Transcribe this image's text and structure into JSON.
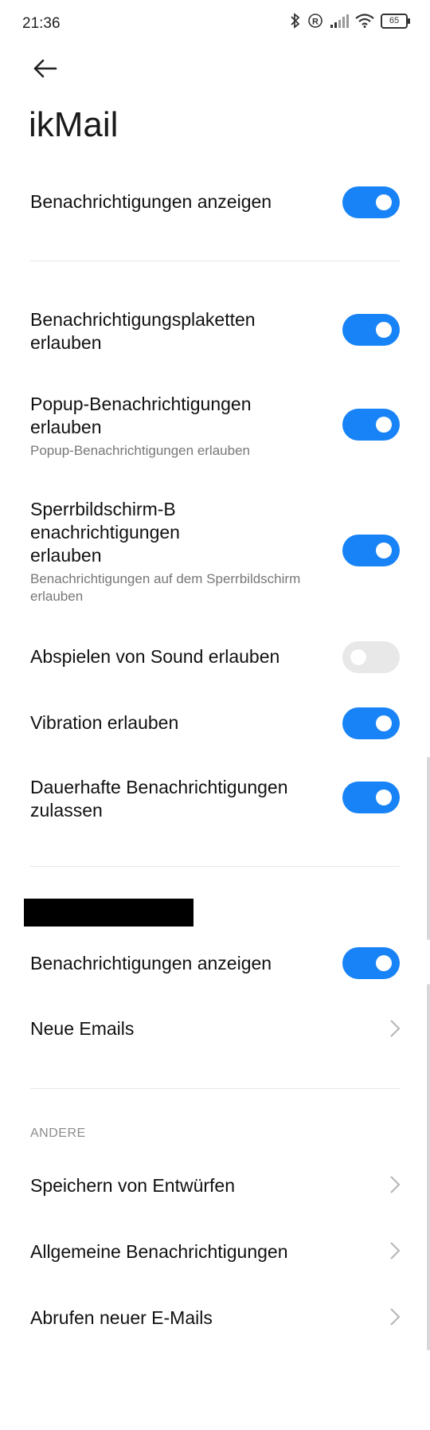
{
  "status_bar": {
    "time": "21:36",
    "battery": "65"
  },
  "header": {
    "app_title": "ikMail"
  },
  "settings": {
    "show_notifications": {
      "title": "Benachrichtigungen anzeigen",
      "on": true
    },
    "badges": {
      "title": "Benachrichtigungsplaketten\nerlauben",
      "on": true
    },
    "popup": {
      "title": "Popup-Benachrichtigungen\nerlauben",
      "subtitle": "Popup-Benachrichtigungen erlauben",
      "on": true
    },
    "lockscreen": {
      "title": "Sperrbildschirm-B\nenachrichtigungen\nerlauben",
      "subtitle": "Benachrichtigungen auf dem Sperrbildschirm\nerlauben",
      "on": true
    },
    "sound": {
      "title": "Abspielen von Sound erlauben",
      "on": false
    },
    "vibration": {
      "title": "Vibration erlauben",
      "on": true
    },
    "persistent": {
      "title": "Dauerhafte Benachrichtigungen\nzulassen",
      "on": true
    }
  },
  "channel": {
    "show_notifications": {
      "title": "Benachrichtigungen anzeigen",
      "on": true
    },
    "new_emails": {
      "title": "Neue Emails"
    }
  },
  "other": {
    "label": "ANDERE",
    "items": [
      {
        "title": "Speichern von Entwürfen"
      },
      {
        "title": "Allgemeine Benachrichtigungen"
      },
      {
        "title": "Abrufen neuer E-Mails"
      }
    ]
  }
}
